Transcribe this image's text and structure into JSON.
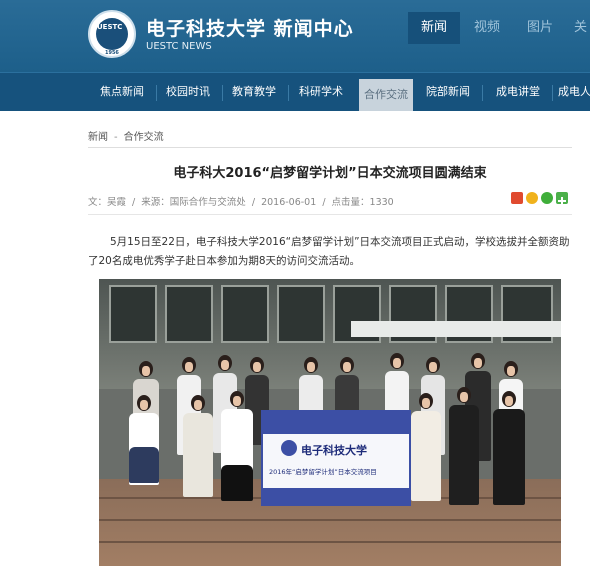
{
  "header": {
    "site_name": "电子科技大学 新闻中心",
    "site_sub": "UESTC NEWS",
    "logo_text": "UESTC",
    "logo_year": "1956",
    "top_tabs": [
      {
        "label": "新闻"
      },
      {
        "label": "视频"
      },
      {
        "label": "图片"
      },
      {
        "label": "关"
      }
    ],
    "active_top_tab": "新闻"
  },
  "nav": {
    "items": [
      {
        "label": "焦点新闻"
      },
      {
        "label": "校园时讯"
      },
      {
        "label": "教育教学"
      },
      {
        "label": "科研学术"
      },
      {
        "label": "合作交流"
      },
      {
        "label": "院部新闻"
      },
      {
        "label": "成电讲堂"
      },
      {
        "label": "成电人"
      }
    ],
    "active": "合作交流"
  },
  "breadcrumb": {
    "home": "新闻",
    "sep": "-",
    "current": "合作交流"
  },
  "article": {
    "title": "电子科大2016“启梦留学计划”日本交流项目圆满结束",
    "meta": {
      "author": "文：吴霞",
      "sep": "/",
      "source": "来源：国际合作与交流处",
      "date": "2016-06-01",
      "hits": "点击量：1330"
    },
    "paragraph": "5月15日至22日，电子科技大学2016“启梦留学计划”日本交流项目正式启动，学校选拔并全额资助了20名成电优秀学子赴日本参加为期8天的访问交流活动。",
    "photo_banner": {
      "name": "电子科技大学",
      "subtitle": "2016年“启梦留学计划”日本交流项目"
    }
  },
  "share_icons": [
    {
      "name": "weibo-icon",
      "color": "#e04a2f"
    },
    {
      "name": "qzone-icon",
      "color": "#f0b21c"
    },
    {
      "name": "wechat-icon",
      "color": "#3fae3a"
    },
    {
      "name": "more-share-icon",
      "color": "#4bb04a"
    }
  ]
}
